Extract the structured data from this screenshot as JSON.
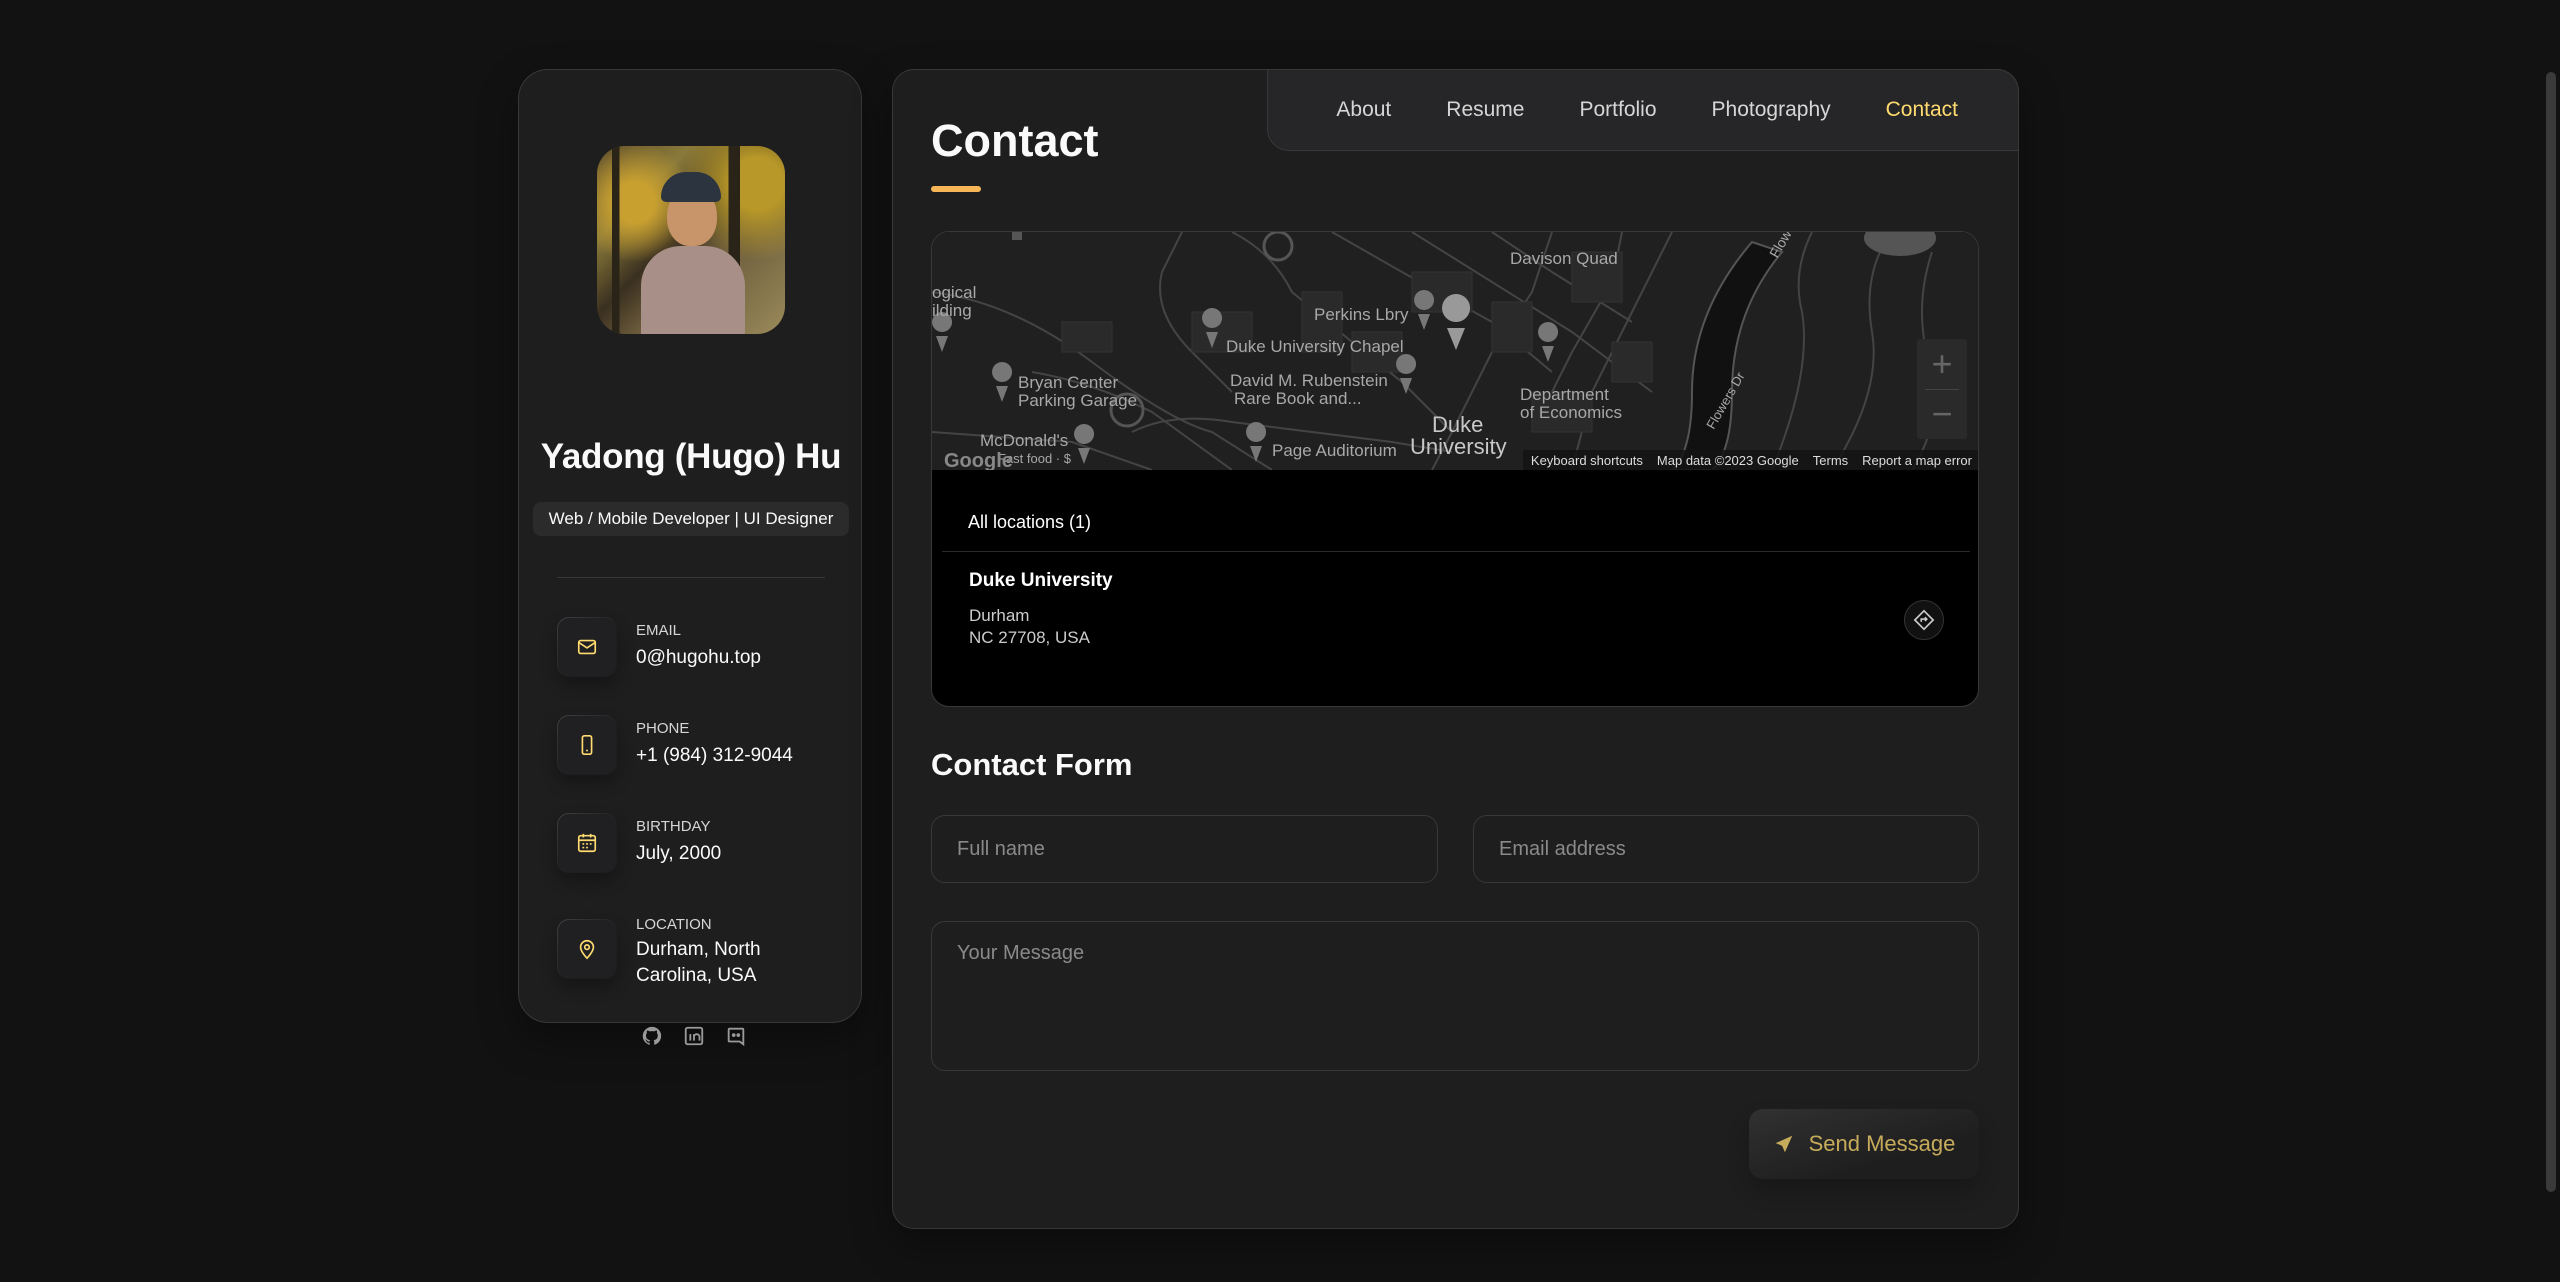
{
  "profile": {
    "name": "Yadong (Hugo) Hu",
    "title": "Web / Mobile Developer | UI Designer"
  },
  "contacts": [
    {
      "label": "Email",
      "value": "0@hugohu.top",
      "icon": "mail-icon"
    },
    {
      "label": "Phone",
      "value": "+1 (984) 312-9044",
      "icon": "phone-icon"
    },
    {
      "label": "Birthday",
      "value": "July, 2000",
      "icon": "calendar-icon"
    },
    {
      "label": "Location",
      "value": "Durham, North Carolina, USA",
      "icon": "location-pin-icon"
    }
  ],
  "socials": [
    "github-icon",
    "linkedin-icon",
    "discord-icon"
  ],
  "nav": {
    "items": [
      "About",
      "Resume",
      "Portfolio",
      "Photography",
      "Contact"
    ],
    "active": "Contact"
  },
  "page": {
    "title": "Contact"
  },
  "map": {
    "labels": {
      "davison": "Davison Quad",
      "perkins": "Perkins Lbry",
      "chapel": "Duke University Chapel",
      "bryan1": "Bryan Center",
      "bryan2": "Parking Garage",
      "rubenstein1": "David M. Rubenstein",
      "rubenstein2": "Rare Book and...",
      "dept1": "Department",
      "dept2": "of Economics",
      "duke1": "Duke",
      "duke2": "University",
      "mcdonalds1": "McDonald's",
      "mcdonalds2": "Fast food · $",
      "page_aud": "Page Auditorium",
      "logical1": "ogical",
      "logical2": "ilding",
      "flowers_dr": "Flowers Dr",
      "flowe": "Flowe"
    },
    "google": "Google",
    "attribution": [
      "Keyboard shortcuts",
      "Map data ©2023 Google",
      "Terms",
      "Report a map error"
    ],
    "zoom_in": "+",
    "zoom_out": "−"
  },
  "locations": {
    "header": "All locations (1)",
    "items": [
      {
        "name": "Duke University",
        "line1": "Durham",
        "line2": "NC 27708, USA"
      }
    ]
  },
  "form": {
    "title": "Contact Form",
    "fullname_placeholder": "Full name",
    "email_placeholder": "Email address",
    "message_placeholder": "Your Message",
    "send_label": "Send Message"
  },
  "colors": {
    "accent": "#ffdb70",
    "underline": "#f6b657",
    "bg": "#121212",
    "card": "#1e1e1f"
  }
}
